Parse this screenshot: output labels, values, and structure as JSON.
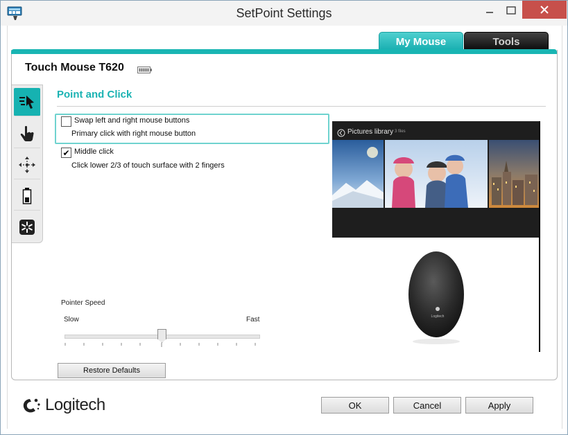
{
  "window": {
    "title": "SetPoint Settings"
  },
  "tabs": [
    {
      "label": "My Mouse",
      "active": true
    },
    {
      "label": "Tools",
      "active": false
    }
  ],
  "device": {
    "name": "Touch Mouse T620"
  },
  "side_tabs": [
    "point-and-click-icon",
    "gesture-hand-icon",
    "scroll-move-icon",
    "battery-icon",
    "settings-star-icon"
  ],
  "section": {
    "title": "Point and Click"
  },
  "options": [
    {
      "label": "Swap left and right mouse buttons",
      "description": "Primary click with right mouse button",
      "checked": false
    },
    {
      "label": "Middle click",
      "description": "Click lower 2/3 of touch surface with 2 fingers",
      "checked": true
    }
  ],
  "checkmark": "✔",
  "preview": {
    "library_title": "Pictures library",
    "library_subtitle": "3 files",
    "mouse_brand": "Logitech"
  },
  "pointer_speed": {
    "label": "Pointer Speed",
    "min_label": "Slow",
    "max_label": "Fast",
    "value": 0.5
  },
  "buttons": {
    "restore": "Restore Defaults",
    "ok": "OK",
    "cancel": "Cancel",
    "apply": "Apply"
  },
  "logo": {
    "text": "Logitech"
  },
  "colors": {
    "accent": "#19b5b3",
    "close": "#c7504b",
    "tools_tab": "#111111"
  }
}
